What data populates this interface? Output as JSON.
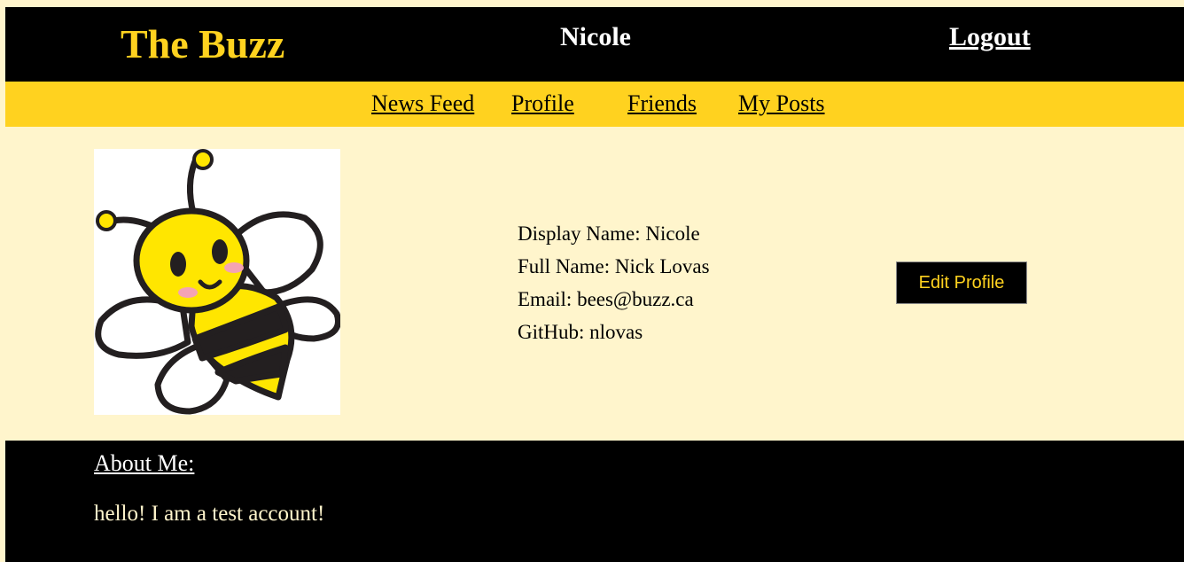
{
  "header": {
    "site_title": "The Buzz",
    "user_name": "Nicole",
    "logout_label": "Logout"
  },
  "nav": {
    "items": [
      {
        "label": "News Feed"
      },
      {
        "label": "Profile"
      },
      {
        "label": "Friends"
      },
      {
        "label": "My Posts"
      }
    ]
  },
  "profile": {
    "avatar_icon": "bee-mascot-icon",
    "display_name": "Display Name: Nicole",
    "full_name": "Full Name: Nick Lovas",
    "email": "Email: bees@buzz.ca",
    "github": "GitHub: nlovas",
    "edit_button_label": "Edit Profile"
  },
  "about": {
    "heading": "About Me:",
    "text": "hello! I am a test account!"
  },
  "colors": {
    "black": "#000000",
    "gold": "#ffd21f",
    "cream": "#fff5cc",
    "white": "#ffffff"
  }
}
